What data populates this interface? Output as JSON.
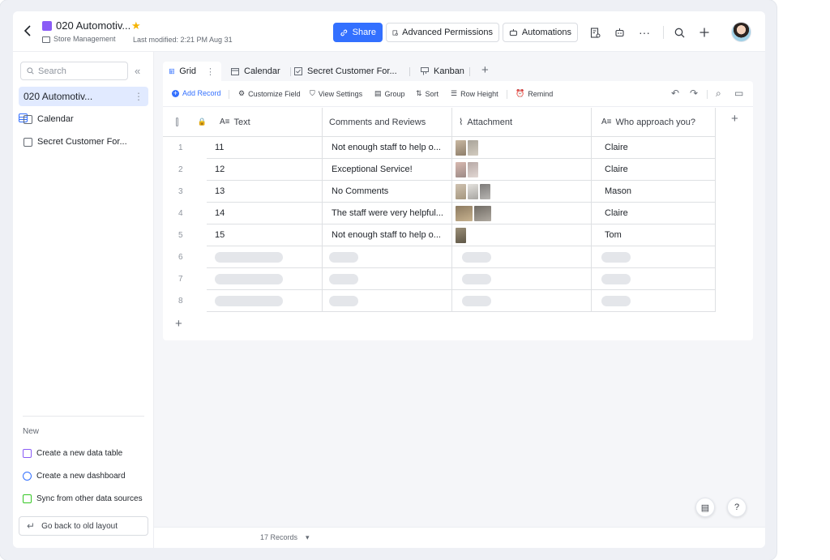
{
  "header": {
    "title": "020 Automotiv...",
    "folder": "Store Management",
    "last_modified": "Last modified: 2:21 PM Aug 31",
    "share_label": "Share",
    "permissions_label": "Advanced Permissions",
    "automations_label": "Automations"
  },
  "sidebar": {
    "search_placeholder": "Search",
    "items": [
      {
        "label": "020 Automotiv..."
      },
      {
        "label": "Calendar"
      },
      {
        "label": "Secret Customer For..."
      }
    ],
    "new_label": "New",
    "new_items": [
      {
        "label": "Create a new data table",
        "color": "#8a5cf6"
      },
      {
        "label": "Create a new dashboard",
        "color": "#3370ff"
      },
      {
        "label": "Sync from other data sources",
        "color": "#34c724"
      }
    ],
    "old_layout_label": "Go back to old layout"
  },
  "tabs": [
    {
      "label": "Grid"
    },
    {
      "label": "Calendar"
    },
    {
      "label": "Secret Customer For..."
    },
    {
      "label": "Kanban"
    }
  ],
  "toolbar": {
    "add_record": "Add Record",
    "customize_field": "Customize Field",
    "view_settings": "View Settings",
    "group": "Group",
    "sort": "Sort",
    "row_height": "Row Height",
    "remind": "Remind"
  },
  "table": {
    "columns": [
      "Text",
      "Comments and Reviews",
      "Attachment",
      "Who approach you?"
    ],
    "rows": [
      {
        "num": "1",
        "text": "11",
        "comment": "Not enough staff to help o...",
        "who": "Claire"
      },
      {
        "num": "2",
        "text": "12",
        "comment": "Exceptional Service!",
        "who": "Claire"
      },
      {
        "num": "3",
        "text": "13",
        "comment": "No Comments",
        "who": "Mason"
      },
      {
        "num": "4",
        "text": "14",
        "comment": "The staff were very helpful...",
        "who": "Claire"
      },
      {
        "num": "5",
        "text": "15",
        "comment": "Not enough staff to help o...",
        "who": "Tom"
      }
    ],
    "loading_rows": [
      "6",
      "7",
      "8"
    ]
  },
  "footer": {
    "records": "17 Records"
  },
  "colors": {
    "accent": "#3370ff",
    "doc_icon": "#8a5cf6",
    "star": "#f5b400"
  }
}
